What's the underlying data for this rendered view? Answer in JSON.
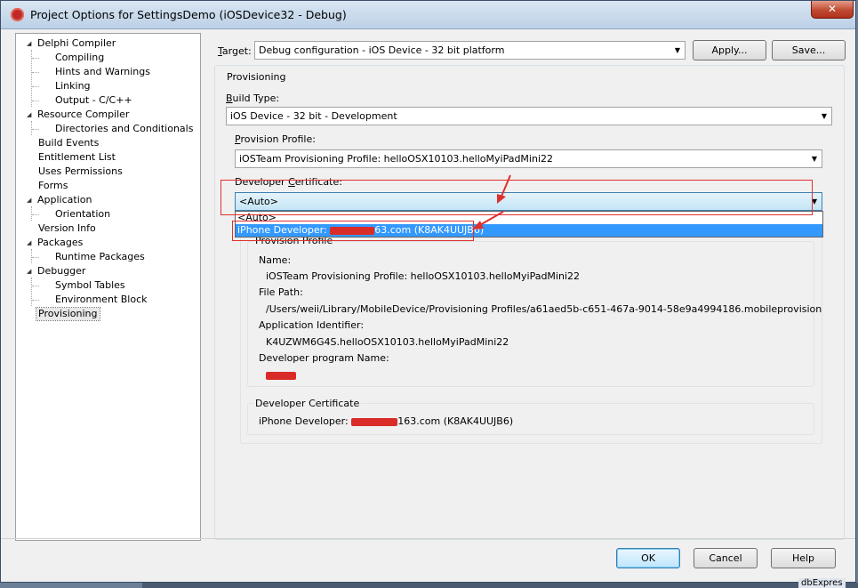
{
  "window": {
    "title": "Project Options for SettingsDemo  (iOSDevice32 - Debug)",
    "close_glyph": "✕"
  },
  "tree": {
    "items": [
      {
        "label": "Delphi Compiler",
        "expander": "◢"
      },
      {
        "label": "Compiling"
      },
      {
        "label": "Hints and Warnings"
      },
      {
        "label": "Linking"
      },
      {
        "label": "Output - C/C++"
      },
      {
        "label": "Resource Compiler",
        "expander": "◢"
      },
      {
        "label": "Directories and Conditionals"
      },
      {
        "label": "Build Events"
      },
      {
        "label": "Entitlement List"
      },
      {
        "label": "Uses Permissions"
      },
      {
        "label": "Forms"
      },
      {
        "label": "Application",
        "expander": "◢"
      },
      {
        "label": "Orientation"
      },
      {
        "label": "Version Info"
      },
      {
        "label": "Packages",
        "expander": "◢"
      },
      {
        "label": "Runtime Packages"
      },
      {
        "label": "Debugger",
        "expander": "◢"
      },
      {
        "label": "Symbol Tables"
      },
      {
        "label": "Environment Block"
      },
      {
        "label": "Provisioning"
      }
    ]
  },
  "target": {
    "label_first": "T",
    "label_rest": "arget:",
    "value": "Debug configuration - iOS Device - 32 bit platform",
    "apply_label": "Apply...",
    "save_label": "Save..."
  },
  "provisioning": {
    "group_label": "Provisioning",
    "build_type_label_first": "B",
    "build_type_label_rest": "uild Type:",
    "build_type_value": "iOS Device - 32 bit - Development",
    "provision_profile_label_first": "P",
    "provision_profile_label_rest": "rovision Profile:",
    "provision_profile_value": "iOSTeam Provisioning Profile: helloOSX10103.helloMyiPadMini22",
    "dev_cert_label_pre": "Developer ",
    "dev_cert_label_u": "C",
    "dev_cert_label_rest": "ertificate:",
    "dev_cert_value": "<Auto>",
    "dropdown": {
      "option_auto": "<Auto>",
      "option_dev_prefix": "iPhone Developer: ",
      "option_dev_suffix": "63.com (K8AK4UUJB6)"
    }
  },
  "profile_info": {
    "group_label": "Provision Profile",
    "name_label": "Name:",
    "name_value": "iOSTeam Provisioning Profile: helloOSX10103.helloMyiPadMini22",
    "path_label": "File Path:",
    "path_value": "/Users/weii/Library/MobileDevice/Provisioning Profiles/a61aed5b-c651-467a-9014-58e9a4994186.mobileprovision",
    "app_id_label": "Application Identifier:",
    "app_id_value": "K4UZWM6G4S.helloOSX10103.helloMyiPadMini22",
    "dev_program_label": "Developer program Name:"
  },
  "cert_info": {
    "group_label": "Developer Certificate",
    "value_prefix": "iPhone Developer: ",
    "value_suffix": "163.com (K8AK4UUJB6)"
  },
  "footer": {
    "ok_label": "OK",
    "cancel_label": "Cancel",
    "help_label": "Help"
  },
  "background": {
    "partial_text": "dbExpres"
  },
  "colors": {
    "selection": "#3399ff",
    "annotation_red": "#e0302b",
    "title_gradient_top": "#d9e6f3"
  }
}
